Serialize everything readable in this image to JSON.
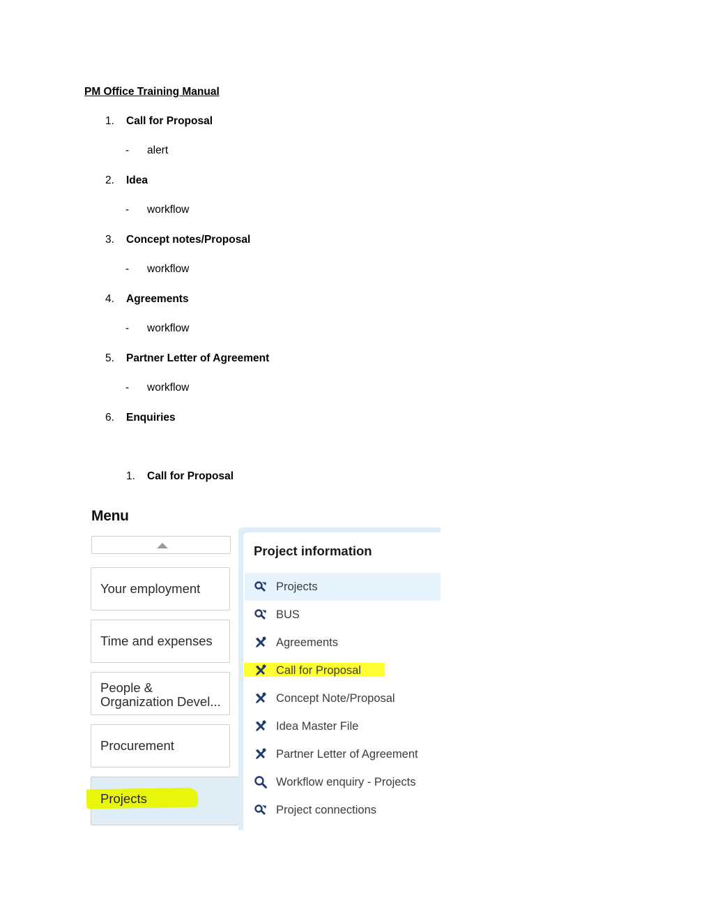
{
  "document": {
    "title": "PM Office Training Manual",
    "outline": [
      {
        "number": "1.",
        "label": "Call for Proposal",
        "sub": "alert"
      },
      {
        "number": "2.",
        "label": "Idea",
        "sub": "workflow"
      },
      {
        "number": "3.",
        "label": "Concept notes/Proposal",
        "sub": "workflow"
      },
      {
        "number": "4.",
        "label": "Agreements",
        "sub": "workflow"
      },
      {
        "number": "5.",
        "label": "Partner Letter of Agreement",
        "sub": "workflow"
      },
      {
        "number": "6.",
        "label": "Enquiries",
        "sub": null
      }
    ],
    "sub_bullet": "-",
    "section_heading": {
      "number": "1.",
      "label": "Call for Proposal"
    }
  },
  "screenshot": {
    "menu": {
      "title": "Menu",
      "scroll_up_icon": "triangle-up-icon",
      "tiles": [
        {
          "label": "Your employment",
          "active": false
        },
        {
          "label": "Time and expenses",
          "active": false
        },
        {
          "label": "People & Organization Devel...",
          "line1": "People &",
          "line2": "Organization Devel...",
          "active": false
        },
        {
          "label": "Procurement",
          "active": false
        },
        {
          "label": "Projects",
          "active": true,
          "highlighted": true
        }
      ]
    },
    "panel": {
      "title": "Project information",
      "items": [
        {
          "label": "Projects",
          "icon": "tools-search-icon",
          "selected": true
        },
        {
          "label": "BUS",
          "icon": "tools-search-icon"
        },
        {
          "label": "Agreements",
          "icon": "tools-icon"
        },
        {
          "label": "Call for Proposal",
          "icon": "tools-icon",
          "highlighted": true
        },
        {
          "label": "Concept Note/Proposal",
          "icon": "tools-icon"
        },
        {
          "label": "Idea Master File",
          "icon": "tools-icon"
        },
        {
          "label": "Partner Letter of Agreement",
          "icon": "tools-icon"
        },
        {
          "label": "Workflow enquiry - Projects",
          "icon": "search-icon"
        },
        {
          "label": "Project connections",
          "icon": "tools-search-icon"
        }
      ]
    },
    "colors": {
      "highlight": "#ffff33",
      "selected_bg": "#e4f3fc",
      "panel_bg": "#deedf6",
      "icon": "#1f3b6e"
    }
  }
}
